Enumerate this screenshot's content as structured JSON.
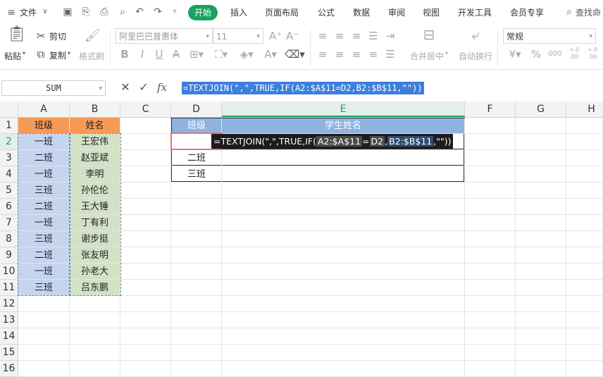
{
  "menu": {
    "file": "文件",
    "tabs": [
      "开始",
      "插入",
      "页面布局",
      "公式",
      "数据",
      "审阅",
      "视图",
      "开发工具",
      "会员专享"
    ],
    "search": "查找命"
  },
  "ribbon": {
    "paste": "粘贴",
    "cut": "剪切",
    "copy": "复制",
    "format_painter": "格式刷",
    "font_name": "阿里巴巴普惠体",
    "font_size": "11",
    "merge_center": "合并居中",
    "wrap_text": "自动换行",
    "number_format": "常规",
    "currency_symbol": "¥",
    "percent_symbol": "%",
    "thousands_symbol": "000",
    "decimal_inc": "+.0 .00",
    "decimal_dec": "+.0 .00"
  },
  "formula_bar": {
    "name_box": "SUM",
    "fx_label": "fx",
    "formula": "=TEXTJOIN(\",\",TRUE,IF(A2:$A$11=D2,B2:$B$11,\"\"))"
  },
  "grid": {
    "columns": [
      "A",
      "B",
      "C",
      "D",
      "E",
      "F",
      "G",
      "H"
    ],
    "rows": [
      "1",
      "2",
      "3",
      "4",
      "5",
      "6",
      "7",
      "8",
      "9",
      "10",
      "11",
      "12",
      "13",
      "14",
      "15",
      "16"
    ],
    "A": [
      "班级",
      "一班",
      "二班",
      "一班",
      "三班",
      "二班",
      "一班",
      "三班",
      "二班",
      "一班",
      "三班"
    ],
    "B": [
      "姓名",
      "王宏伟",
      "赵亚斌",
      "李明",
      "孙伦伦",
      "王大锤",
      "丁有利",
      "谢步挺",
      "张友明",
      "孙老大",
      "吕东鹏"
    ],
    "D": [
      "班级",
      "",
      "二班",
      "三班"
    ],
    "E1": "学生姓名"
  },
  "editor": {
    "prefix": "=TEXTJOIN(\",\",TRUE,IF(",
    "range1": "A2:$A$11",
    "eq": "=",
    "ref": "D2",
    "comma": ",",
    "range2": "B2:$B$11",
    "suffix": ",\"\"))"
  },
  "colors": {
    "accent": "#1aa25f",
    "header_orange": "#f79a55",
    "class_blue": "#c5d4ef",
    "name_green": "#d3e1c6",
    "table_header_blue": "#8fb2e0"
  }
}
